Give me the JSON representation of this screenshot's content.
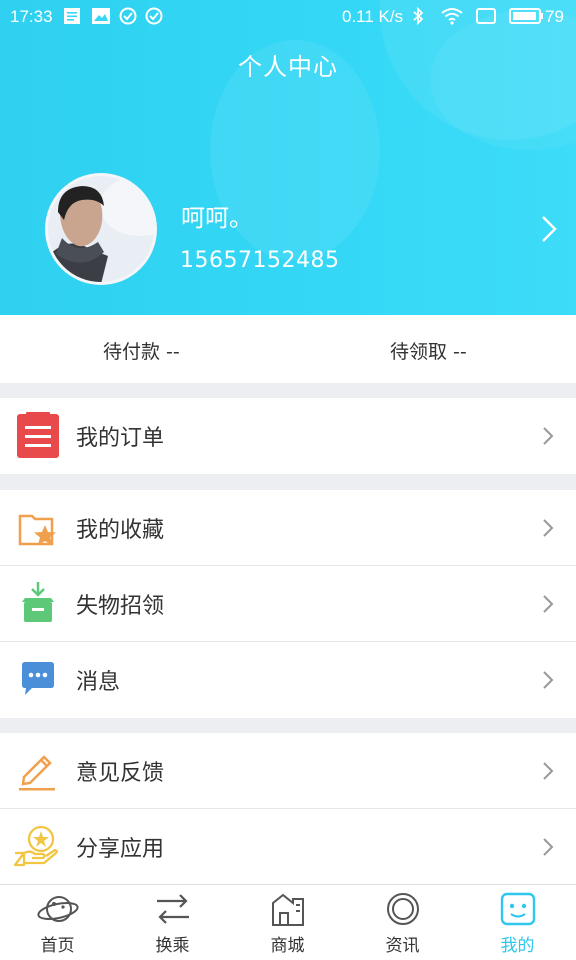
{
  "status_bar": {
    "time": "17:33",
    "speed": "0.11 K/s",
    "battery": "79"
  },
  "header": {
    "title": "个人中心"
  },
  "profile": {
    "name": "呵呵。",
    "phone": "15657152485"
  },
  "pending": [
    {
      "label": "待付款  --"
    },
    {
      "label": "待领取  --"
    }
  ],
  "menu_groups": [
    {
      "items": [
        {
          "label": "我的订单",
          "icon": "orders-icon"
        }
      ]
    },
    {
      "items": [
        {
          "label": "我的收藏",
          "icon": "favorites-star-icon"
        },
        {
          "label": "失物招领",
          "icon": "lost-found-box-icon"
        },
        {
          "label": "消息",
          "icon": "message-bubble-icon"
        }
      ]
    },
    {
      "items": [
        {
          "label": "意见反馈",
          "icon": "feedback-pencil-icon"
        },
        {
          "label": "分享应用",
          "icon": "share-hand-star-icon"
        }
      ]
    }
  ],
  "bottom_nav": [
    {
      "label": "首页",
      "icon": "planet-icon"
    },
    {
      "label": "换乘",
      "icon": "transfer-arrows-icon"
    },
    {
      "label": "商城",
      "icon": "shop-building-icon"
    },
    {
      "label": "资讯",
      "icon": "news-circle-icon"
    },
    {
      "label": "我的",
      "icon": "profile-robot-icon",
      "active": true
    }
  ],
  "colors": {
    "header": "#34d8f6",
    "active_tab": "#2fc6ef",
    "orders_icon": "#e84a4b"
  }
}
